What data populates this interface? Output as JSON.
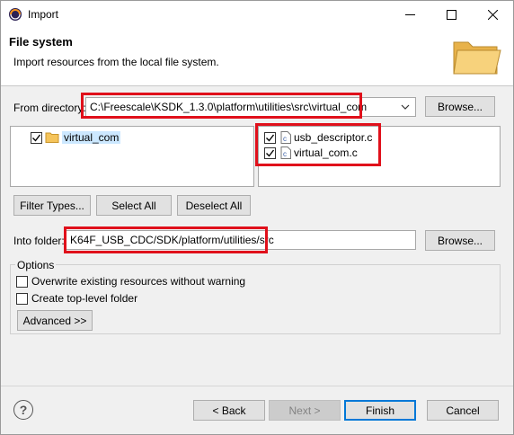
{
  "window": {
    "title": "Import",
    "controls": [
      "minimize",
      "maximize",
      "close"
    ]
  },
  "header": {
    "title": "File system",
    "description": "Import resources from the local file system."
  },
  "from_directory": {
    "label": "From directory:",
    "value": "C:\\Freescale\\KSDK_1.3.0\\platform\\utilities\\src\\virtual_com",
    "browse_label": "Browse..."
  },
  "folder_tree": {
    "items": [
      {
        "label": "virtual_com",
        "checked": true
      }
    ]
  },
  "file_list": {
    "items": [
      {
        "label": "usb_descriptor.c",
        "checked": true
      },
      {
        "label": "virtual_com.c",
        "checked": true
      }
    ]
  },
  "selection_buttons": {
    "filter_types": "Filter Types...",
    "select_all": "Select All",
    "deselect_all": "Deselect All"
  },
  "into_folder": {
    "label": "Into folder:",
    "value": "K64F_USB_CDC/SDK/platform/utilities/src",
    "browse_label": "Browse..."
  },
  "options": {
    "title": "Options",
    "overwrite": {
      "label": "Overwrite existing resources without warning",
      "checked": false
    },
    "create_top_level": {
      "label": "Create top-level folder",
      "checked": false
    },
    "advanced_label": "Advanced >>"
  },
  "footer": {
    "back_label": "< Back",
    "next_label": "Next >",
    "finish_label": "Finish",
    "cancel_label": "Cancel"
  },
  "colors": {
    "highlight": "#e0101b",
    "default_button_border": "#0078d7",
    "folder_fill": "#f5c45b"
  },
  "icons": [
    "app-icon",
    "minimize-icon",
    "maximize-icon",
    "close-icon",
    "folder-banner-icon",
    "folder-icon",
    "c-file-icon",
    "chevron-down-icon",
    "help-icon",
    "check-icon"
  ]
}
